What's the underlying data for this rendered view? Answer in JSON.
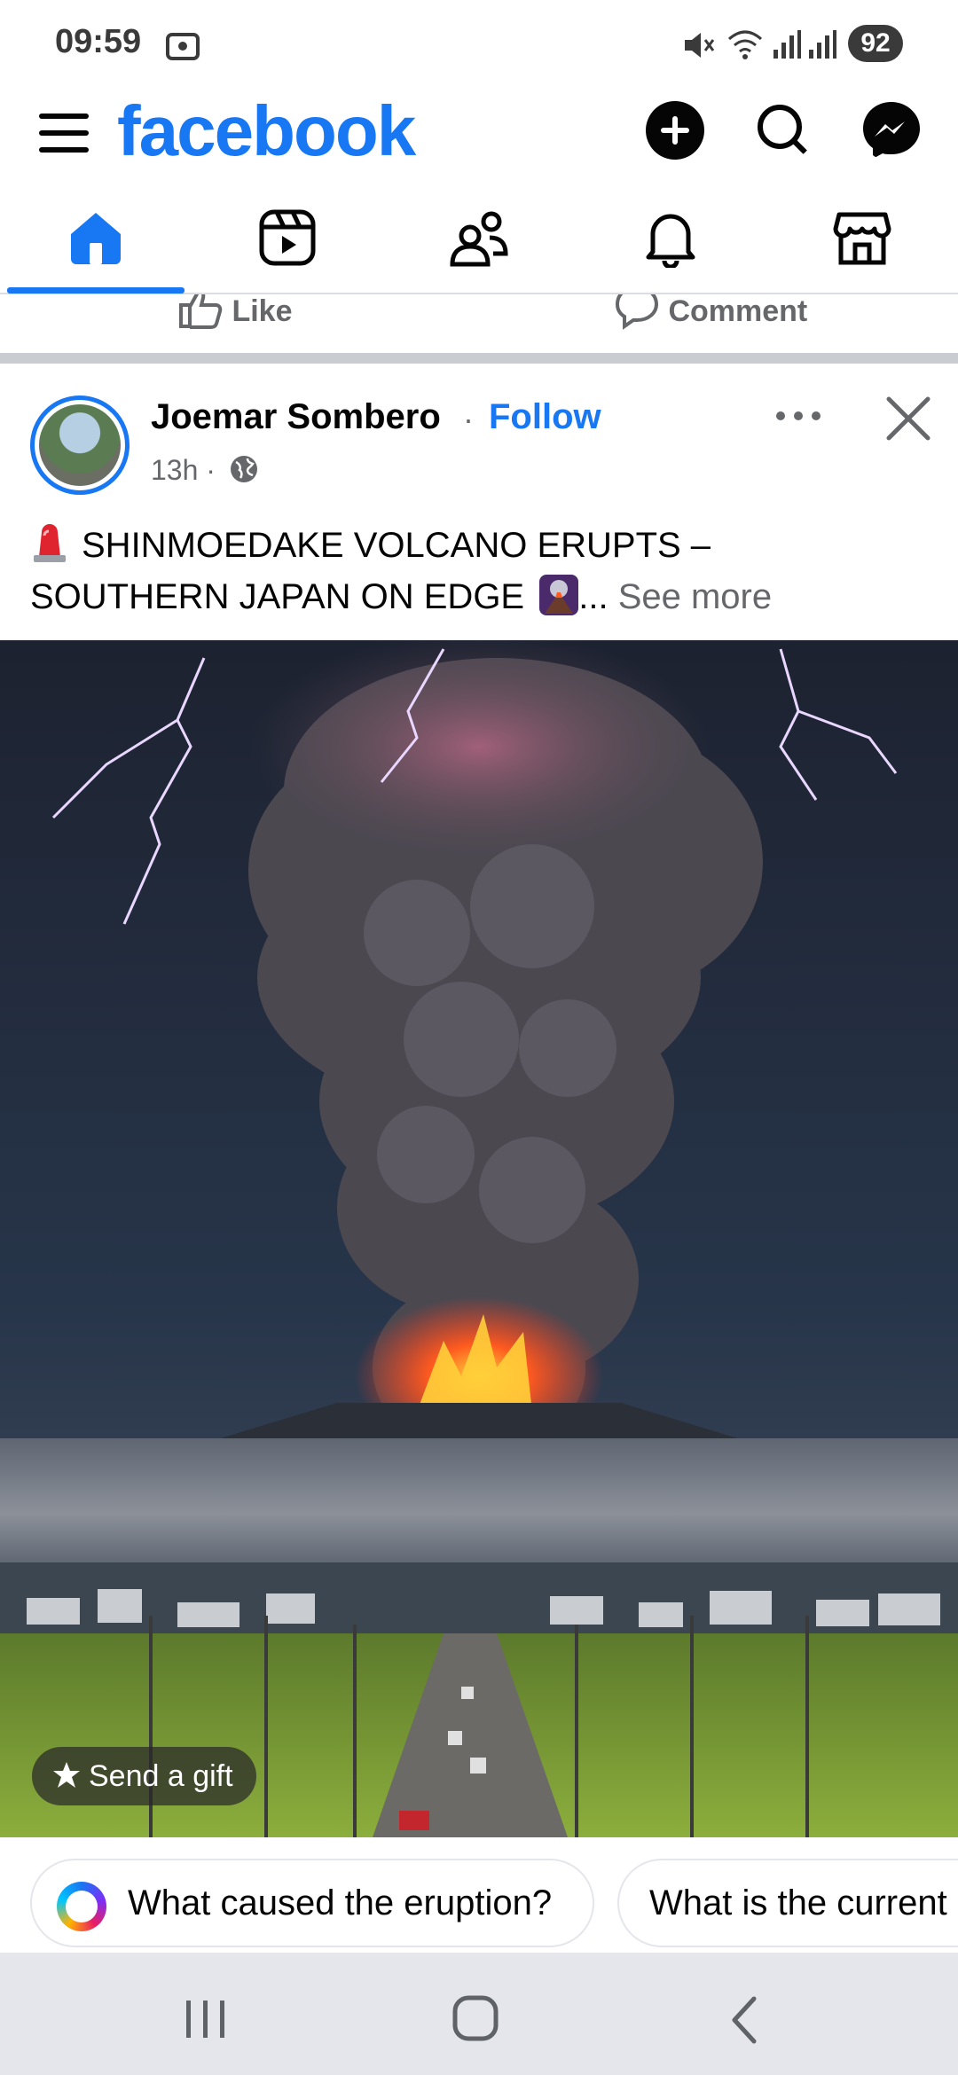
{
  "status_bar": {
    "time": "09:59",
    "battery": "92"
  },
  "header": {
    "logo": "facebook"
  },
  "tabs": [
    {
      "name": "home",
      "active": true
    },
    {
      "name": "reels"
    },
    {
      "name": "friends"
    },
    {
      "name": "notifications"
    },
    {
      "name": "marketplace"
    }
  ],
  "previous_post": {
    "like_label": "Like",
    "comment_label": "Comment"
  },
  "post": {
    "author": "Joemar Sombero",
    "separator": "·",
    "follow_label": "Follow",
    "time": "13h ·",
    "caption_line1": "SHINMOEDAKE VOLCANO ERUPTS –",
    "caption_line2": "SOUTHERN JAPAN ON EDGE",
    "ellipsis": "...",
    "see_more": "See more",
    "gift_label": "Send a gift"
  },
  "suggestions": [
    {
      "label": "What caused the eruption?"
    },
    {
      "label": "What is the current"
    }
  ],
  "colors": {
    "brand": "#1877f2",
    "secondary_text": "#65676b"
  }
}
